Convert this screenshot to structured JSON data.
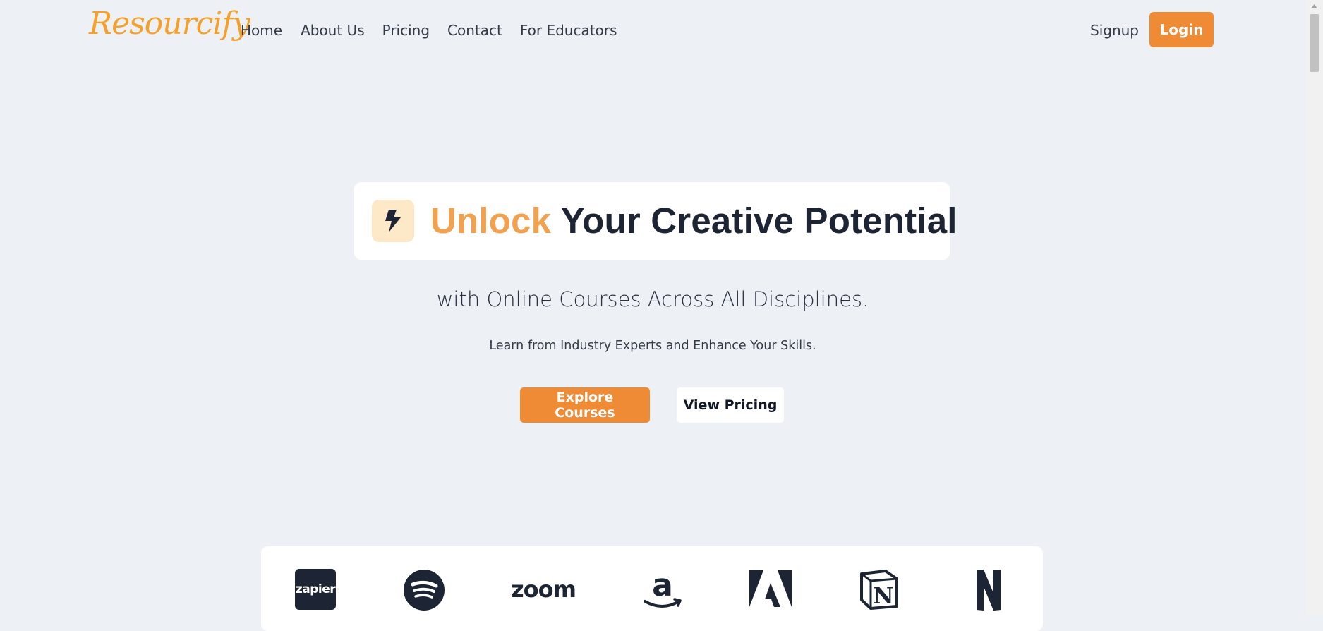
{
  "brand": {
    "name": "Resourcify",
    "accent_color": "#ef8a35",
    "logo_color": "#f5a02a"
  },
  "nav": {
    "items": [
      {
        "label": "Home"
      },
      {
        "label": "About Us"
      },
      {
        "label": "Pricing"
      },
      {
        "label": "Contact"
      },
      {
        "label": "For Educators"
      }
    ],
    "signup_label": "Signup",
    "login_label": "Login"
  },
  "hero": {
    "icon": "lightning-bolt-icon",
    "title_accent": "Unlock",
    "title_rest": "Your Creative Potential",
    "subheading": "with Online Courses Across All Disciplines.",
    "tagline": "Learn from Industry Experts and Enhance Your Skills.",
    "primary_button": "Explore Courses",
    "secondary_button": "View Pricing"
  },
  "partners": {
    "logos": [
      {
        "name": "zapier-logo",
        "text": "zapier"
      },
      {
        "name": "spotify-logo"
      },
      {
        "name": "zoom-logo",
        "text": "zoom"
      },
      {
        "name": "amazon-logo",
        "text": "a"
      },
      {
        "name": "adobe-logo"
      },
      {
        "name": "notion-logo",
        "text": "N"
      },
      {
        "name": "netflix-logo",
        "text": "N"
      }
    ]
  }
}
